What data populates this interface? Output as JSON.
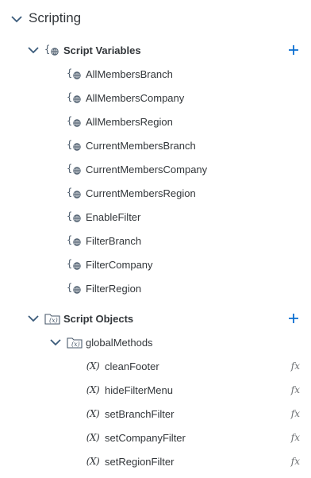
{
  "root": {
    "label": "Scripting"
  },
  "script_variables": {
    "label": "Script Variables",
    "add_icon": "plus-icon",
    "items": [
      "AllMembersBranch",
      "AllMembersCompany",
      "AllMembersRegion",
      "CurrentMembersBranch",
      "CurrentMembersCompany",
      "CurrentMembersRegion",
      "EnableFilter",
      "FilterBranch",
      "FilterCompany",
      "FilterRegion"
    ]
  },
  "script_objects": {
    "label": "Script Objects",
    "add_icon": "plus-icon",
    "group": {
      "label": "globalMethods",
      "functions": [
        {
          "name": "cleanFooter",
          "badge": "fx"
        },
        {
          "name": "hideFilterMenu",
          "badge": "fx"
        },
        {
          "name": "setBranchFilter",
          "badge": "fx"
        },
        {
          "name": "setCompanyFilter",
          "badge": "fx"
        },
        {
          "name": "setRegionFilter",
          "badge": "fx"
        }
      ]
    }
  },
  "colors": {
    "accent": "#0a6ed1",
    "text": "#32363a",
    "icon": "#4a5a6b"
  }
}
